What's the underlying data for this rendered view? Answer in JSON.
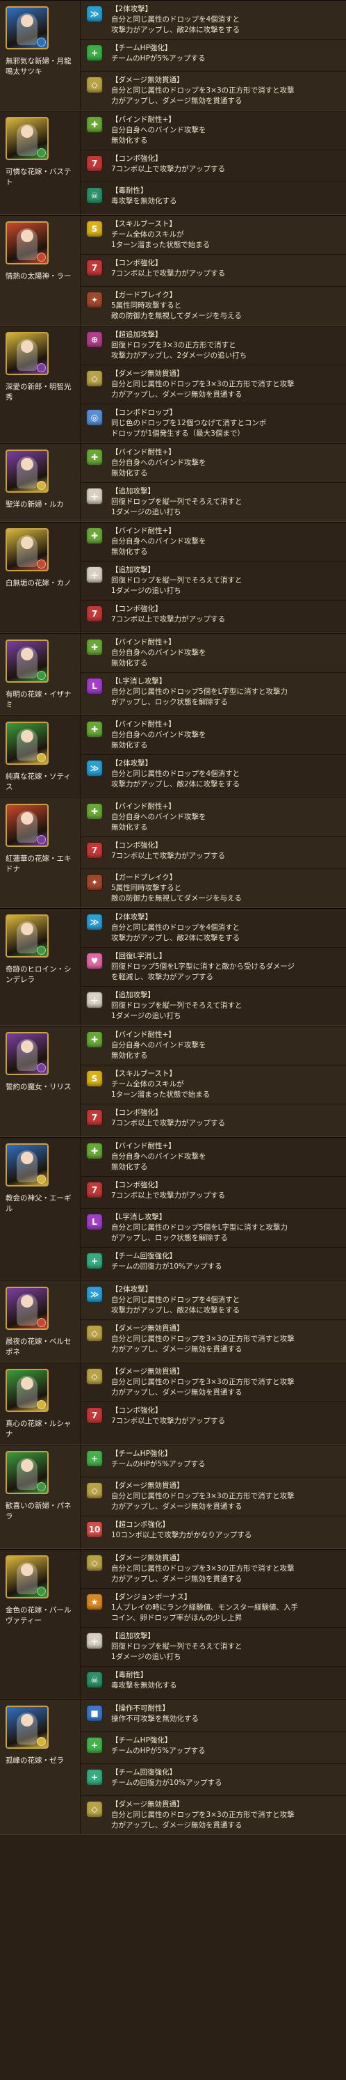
{
  "colors": {
    "attr": {
      "fire": "#c8482c",
      "water": "#2f6fc0",
      "wood": "#3d9a3c",
      "light": "#d6b43c",
      "dark": "#7a3fa0"
    },
    "awakening": {
      "2-combo-icon": "#2e9fd0",
      "hp-plus-icon": "#3fae48",
      "dmg-pierce-icon": "#b9a34a",
      "bind-resist-icon": "#6aa838",
      "7-combo-icon": "#c13a3a",
      "poison-resist-icon": "#2e8f6a",
      "skill-boost-icon": "#d9b11e",
      "guard-break-icon": "#9f4a2e",
      "super-extra-attack-icon": "#b04088",
      "combo-drop-icon": "#5a8fd4",
      "extra-attack-icon": "#d8d0c0",
      "l-unlock-icon": "#a23fc8",
      "team-heal-icon": "#3aaa82",
      "heal-l-icon": "#e06aa6",
      "team-hp-icon": "#48b04c",
      "10-combo-icon": "#d4504a",
      "dungeon-bonus-icon": "#d88a26",
      "unmovable-resist-icon": "#3e78c6"
    }
  },
  "cards": [
    {
      "name": "無邪気な新婦・月龍鳴太サツキ",
      "main": "water",
      "sub": "water",
      "awakenings": [
        {
          "icon": "2-combo-icon",
          "glyph": "≫",
          "title": "【2体攻撃】",
          "desc": "自分と同じ属性のドロップを4個消すと\n攻撃力がアップし、敵2体に攻撃をする"
        },
        {
          "icon": "hp-plus-icon",
          "glyph": "+",
          "title": "【チームHP強化】",
          "desc": "チームのHPが5%アップする"
        },
        {
          "icon": "dmg-pierce-icon",
          "glyph": "◇",
          "title": "【ダメージ無効貫通】",
          "desc": "自分と同じ属性のドロップを3×3の正方形で消すと攻撃\n力がアップし、ダメージ無効を貫通する"
        }
      ]
    },
    {
      "name": "可憐な花嫁・バステト",
      "main": "light",
      "sub": "wood",
      "awakenings": [
        {
          "icon": "bind-resist-icon",
          "glyph": "✚",
          "title": "【バインド耐性+】",
          "desc": "自分自身へのバインド攻撃を\n無効化する"
        },
        {
          "icon": "7-combo-icon",
          "glyph": "7",
          "title": "【コンボ強化】",
          "desc": "7コンボ以上で攻撃力がアップする"
        },
        {
          "icon": "poison-resist-icon",
          "glyph": "☠",
          "title": "【毒耐性】",
          "desc": "毒攻撃を無効化する"
        }
      ]
    },
    {
      "name": "情熱の太陽神・ラー",
      "main": "fire",
      "sub": "fire",
      "awakenings": [
        {
          "icon": "skill-boost-icon",
          "glyph": "S",
          "title": "【スキルブースト】",
          "desc": "チーム全体のスキルが\n1ターン溜まった状態で始まる"
        },
        {
          "icon": "7-combo-icon",
          "glyph": "7",
          "title": "【コンボ強化】",
          "desc": "7コンボ以上で攻撃力がアップする"
        },
        {
          "icon": "guard-break-icon",
          "glyph": "✦",
          "title": "【ガードブレイク】",
          "desc": "5属性同時攻撃すると\n敵の防御力を無視してダメージを与える"
        }
      ]
    },
    {
      "name": "深愛の新郎・明智光秀",
      "main": "light",
      "sub": "dark",
      "awakenings": [
        {
          "icon": "super-extra-attack-icon",
          "glyph": "⊕",
          "title": "【超追加攻撃】",
          "desc": "回復ドロップを3×3の正方形で消すと\n攻撃力がアップし、2ダメージの追い打ち"
        },
        {
          "icon": "dmg-pierce-icon",
          "glyph": "◇",
          "title": "【ダメージ無効貫通】",
          "desc": "自分と同じ属性のドロップを3×3の正方形で消すと攻撃\n力がアップし、ダメージ無効を貫通する"
        },
        {
          "icon": "combo-drop-icon",
          "glyph": "◎",
          "title": "【コンボドロップ】",
          "desc": "同じ色のドロップを12個つなげて消すとコンボ\nドロップが1個発生する（最大3個まで）"
        }
      ]
    },
    {
      "name": "聖洋の新婦・ルカ",
      "main": "dark",
      "sub": "light",
      "awakenings": [
        {
          "icon": "bind-resist-icon",
          "glyph": "✚",
          "title": "【バインド耐性+】",
          "desc": "自分自身へのバインド攻撃を\n無効化する"
        },
        {
          "icon": "extra-attack-icon",
          "glyph": "＋",
          "title": "【追加攻撃】",
          "desc": "回復ドロップを縦一列でそろえて消すと\n1ダメージの追い打ち"
        }
      ]
    },
    {
      "name": "白無垢の花嫁・カノ",
      "main": "light",
      "sub": "fire",
      "awakenings": [
        {
          "icon": "bind-resist-icon",
          "glyph": "✚",
          "title": "【バインド耐性+】",
          "desc": "自分自身へのバインド攻撃を\n無効化する"
        },
        {
          "icon": "extra-attack-icon",
          "glyph": "＋",
          "title": "【追加攻撃】",
          "desc": "回復ドロップを縦一列でそろえて消すと\n1ダメージの追い打ち"
        },
        {
          "icon": "7-combo-icon",
          "glyph": "7",
          "title": "【コンボ強化】",
          "desc": "7コンボ以上で攻撃力がアップする"
        }
      ]
    },
    {
      "name": "有明の花嫁・イザナミ",
      "main": "dark",
      "sub": "wood",
      "awakenings": [
        {
          "icon": "bind-resist-icon",
          "glyph": "✚",
          "title": "【バインド耐性+】",
          "desc": "自分自身へのバインド攻撃を\n無効化する"
        },
        {
          "icon": "l-unlock-icon",
          "glyph": "L",
          "title": "【L字消し攻撃】",
          "desc": "自分と同じ属性のドロップ5個をL字型に消すと攻撃力\nがアップし、ロック状態を解除する"
        }
      ]
    },
    {
      "name": "純真な花嫁・ソティス",
      "main": "wood",
      "sub": "light",
      "awakenings": [
        {
          "icon": "bind-resist-icon",
          "glyph": "✚",
          "title": "【バインド耐性+】",
          "desc": "自分自身へのバインド攻撃を\n無効化する"
        },
        {
          "icon": "2-combo-icon",
          "glyph": "≫",
          "title": "【2体攻撃】",
          "desc": "自分と同じ属性のドロップを4個消すと\n攻撃力がアップし、敵2体に攻撃をする"
        }
      ]
    },
    {
      "name": "紅蓮華の花嫁・エキドナ",
      "main": "fire",
      "sub": "dark",
      "awakenings": [
        {
          "icon": "bind-resist-icon",
          "glyph": "✚",
          "title": "【バインド耐性+】",
          "desc": "自分自身へのバインド攻撃を\n無効化する"
        },
        {
          "icon": "7-combo-icon",
          "glyph": "7",
          "title": "【コンボ強化】",
          "desc": "7コンボ以上で攻撃力がアップする"
        },
        {
          "icon": "guard-break-icon",
          "glyph": "✦",
          "title": "【ガードブレイク】",
          "desc": "5属性同時攻撃すると\n敵の防御力を無視してダメージを与える"
        }
      ]
    },
    {
      "name": "奇跡のヒロイン・シンデレラ",
      "main": "light",
      "sub": "wood",
      "awakenings": [
        {
          "icon": "2-combo-icon",
          "glyph": "≫",
          "title": "【2体攻撃】",
          "desc": "自分と同じ属性のドロップを4個消すと\n攻撃力がアップし、敵2体に攻撃をする"
        },
        {
          "icon": "heal-l-icon",
          "glyph": "♥",
          "title": "【回復L字消し】",
          "desc": "回復ドロップ5個をL字型に消すと敵から受けるダメージ\nを軽減し、攻撃力がアップする"
        },
        {
          "icon": "extra-attack-icon",
          "glyph": "＋",
          "title": "【追加攻撃】",
          "desc": "回復ドロップを縦一列でそろえて消すと\n1ダメージの追い打ち"
        }
      ]
    },
    {
      "name": "誓約の魔女・リリス",
      "main": "dark",
      "sub": "dark",
      "awakenings": [
        {
          "icon": "bind-resist-icon",
          "glyph": "✚",
          "title": "【バインド耐性+】",
          "desc": "自分自身へのバインド攻撃を\n無効化する"
        },
        {
          "icon": "skill-boost-icon",
          "glyph": "S",
          "title": "【スキルブースト】",
          "desc": "チーム全体のスキルが\n1ターン溜まった状態で始まる"
        },
        {
          "icon": "7-combo-icon",
          "glyph": "7",
          "title": "【コンボ強化】",
          "desc": "7コンボ以上で攻撃力がアップする"
        }
      ]
    },
    {
      "name": "教会の神父・エーギル",
      "main": "water",
      "sub": "light",
      "awakenings": [
        {
          "icon": "bind-resist-icon",
          "glyph": "✚",
          "title": "【バインド耐性+】",
          "desc": "自分自身へのバインド攻撃を\n無効化する"
        },
        {
          "icon": "7-combo-icon",
          "glyph": "7",
          "title": "【コンボ強化】",
          "desc": "7コンボ以上で攻撃力がアップする"
        },
        {
          "icon": "l-unlock-icon",
          "glyph": "L",
          "title": "【L字消し攻撃】",
          "desc": "自分と同じ属性のドロップ5個をL字型に消すと攻撃力\nがアップし、ロック状態を解除する"
        },
        {
          "icon": "team-heal-icon",
          "glyph": "+",
          "title": "【チーム回復強化】",
          "desc": "チームの回復力が10%アップする"
        }
      ]
    },
    {
      "name": "晨夜の花嫁・ペルセポネ",
      "main": "dark",
      "sub": "fire",
      "awakenings": [
        {
          "icon": "2-combo-icon",
          "glyph": "≫",
          "title": "【2体攻撃】",
          "desc": "自分と同じ属性のドロップを4個消すと\n攻撃力がアップし、敵2体に攻撃をする"
        },
        {
          "icon": "dmg-pierce-icon",
          "glyph": "◇",
          "title": "【ダメージ無効貫通】",
          "desc": "自分と同じ属性のドロップを3×3の正方形で消すと攻撃\n力がアップし、ダメージ無効を貫通する"
        }
      ]
    },
    {
      "name": "真心の花嫁・ルシャナ",
      "main": "wood",
      "sub": "light",
      "awakenings": [
        {
          "icon": "dmg-pierce-icon",
          "glyph": "◇",
          "title": "【ダメージ無効貫通】",
          "desc": "自分と同じ属性のドロップを3×3の正方形で消すと攻撃\n力がアップし、ダメージ無効を貫通する"
        },
        {
          "icon": "7-combo-icon",
          "glyph": "7",
          "title": "【コンボ強化】",
          "desc": "7コンボ以上で攻撃力がアップする"
        }
      ]
    },
    {
      "name": "歓喜いの新婦・パネラ",
      "main": "wood",
      "sub": "wood",
      "awakenings": [
        {
          "icon": "team-hp-icon",
          "glyph": "+",
          "title": "【チームHP強化】",
          "desc": "チームのHPが5%アップする"
        },
        {
          "icon": "dmg-pierce-icon",
          "glyph": "◇",
          "title": "【ダメージ無効貫通】",
          "desc": "自分と同じ属性のドロップを3×3の正方形で消すと攻撃\n力がアップし、ダメージ無効を貫通する"
        },
        {
          "icon": "10-combo-icon",
          "glyph": "10",
          "title": "【超コンボ強化】",
          "desc": "10コンボ以上で攻撃力がかなりアップする"
        }
      ]
    },
    {
      "name": "金色の花嫁・パールヴァティー",
      "main": "light",
      "sub": "wood",
      "awakenings": [
        {
          "icon": "dmg-pierce-icon",
          "glyph": "◇",
          "title": "【ダメージ無効貫通】",
          "desc": "自分と同じ属性のドロップを3×3の正方形で消すと攻撃\n力がアップし、ダメージ無効を貫通する"
        },
        {
          "icon": "dungeon-bonus-icon",
          "glyph": "★",
          "title": "【ダンジョンボーナス】",
          "desc": "1人プレイの時にランク経験値、モンスター経験値、入手\nコイン、卵ドロップ率がほんの少し上昇"
        },
        {
          "icon": "extra-attack-icon",
          "glyph": "＋",
          "title": "【追加攻撃】",
          "desc": "回復ドロップを縦一列でそろえて消すと\n1ダメージの追い打ち"
        },
        {
          "icon": "poison-resist-icon",
          "glyph": "☠",
          "title": "【毒耐性】",
          "desc": "毒攻撃を無効化する"
        }
      ]
    },
    {
      "name": "孤峰の花嫁・ゼラ",
      "main": "water",
      "sub": "light",
      "awakenings": [
        {
          "icon": "unmovable-resist-icon",
          "glyph": "■",
          "title": "【操作不可耐性】",
          "desc": "操作不可攻撃を無効化する"
        },
        {
          "icon": "team-hp-icon",
          "glyph": "+",
          "title": "【チームHP強化】",
          "desc": "チームのHPが5%アップする"
        },
        {
          "icon": "team-heal-icon",
          "glyph": "+",
          "title": "【チーム回復強化】",
          "desc": "チームの回復力が10%アップする"
        },
        {
          "icon": "dmg-pierce-icon",
          "glyph": "◇",
          "title": "【ダメージ無効貫通】",
          "desc": "自分と同じ属性のドロップを3×3の正方形で消すと攻撃\n力がアップし、ダメージ無効を貫通する"
        }
      ]
    }
  ]
}
